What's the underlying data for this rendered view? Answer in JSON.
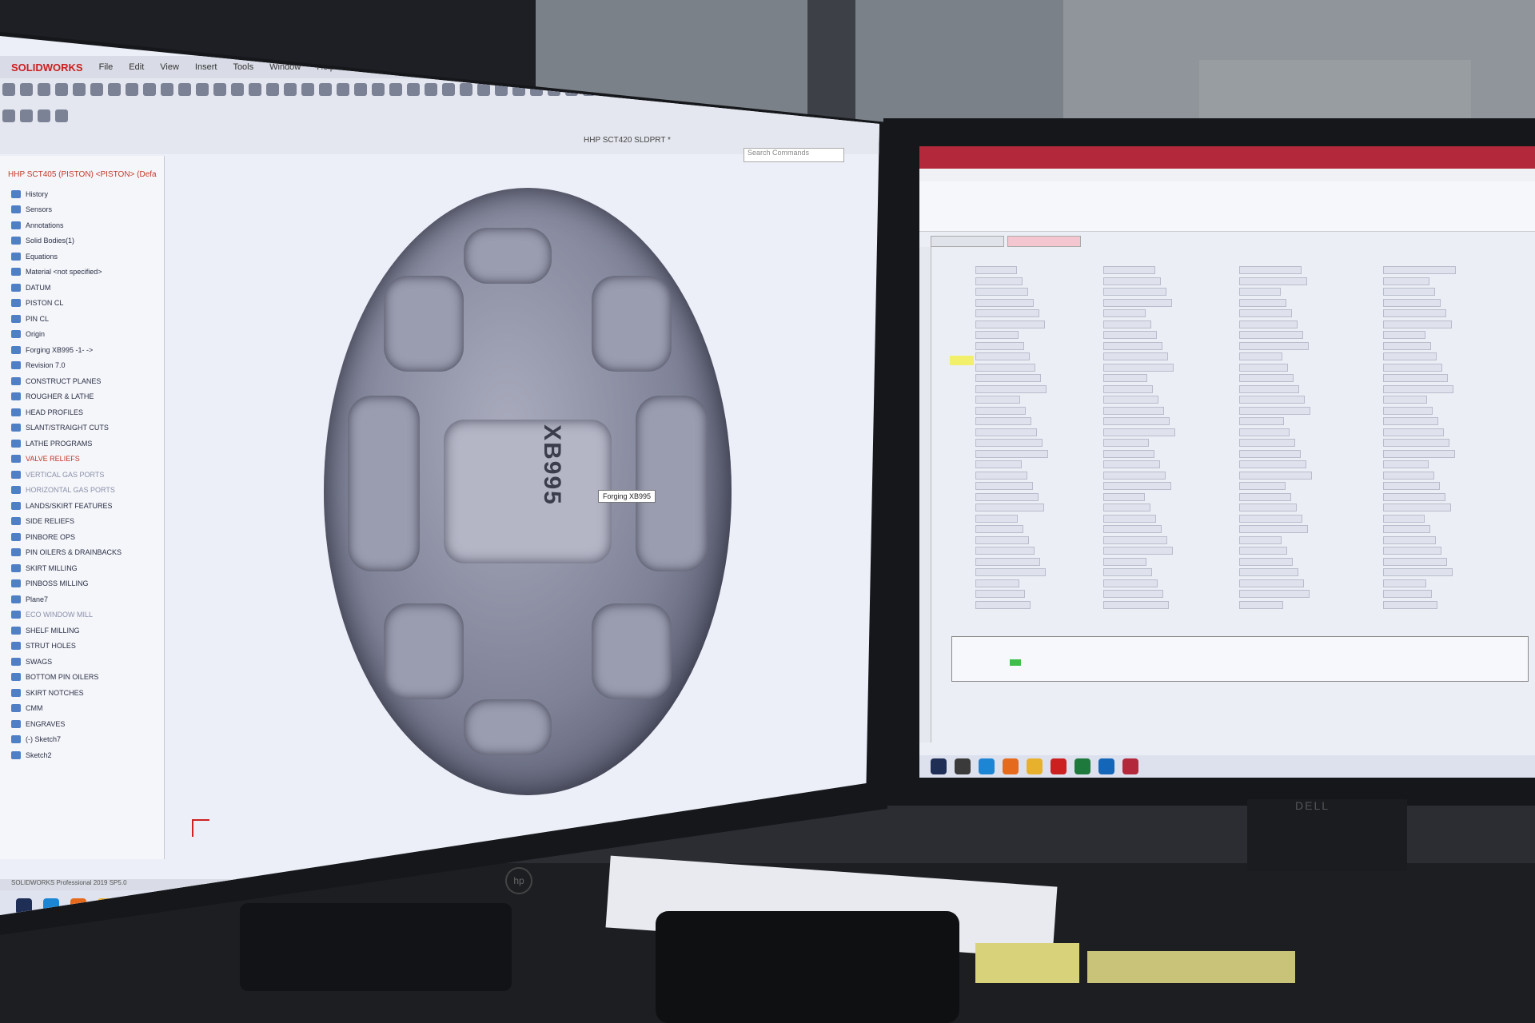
{
  "left_app": {
    "brand": "SOLIDWORKS",
    "menu": [
      "File",
      "Edit",
      "View",
      "Insert",
      "Tools",
      "Window",
      "Help"
    ],
    "document_title": "HHP SCT420 SLDPRT *",
    "search_placeholder": "Search Commands",
    "tree_root": "HHP SCT405 (PISTON) <PISTON> (Defa",
    "tree_items": [
      {
        "label": "History",
        "style": "normal"
      },
      {
        "label": "Sensors",
        "style": "normal"
      },
      {
        "label": "Annotations",
        "style": "normal"
      },
      {
        "label": "Solid Bodies(1)",
        "style": "normal"
      },
      {
        "label": "Equations",
        "style": "normal"
      },
      {
        "label": "Material <not specified>",
        "style": "normal"
      },
      {
        "label": "DATUM",
        "style": "normal"
      },
      {
        "label": "PISTON CL",
        "style": "normal"
      },
      {
        "label": "PIN CL",
        "style": "normal"
      },
      {
        "label": "Origin",
        "style": "normal"
      },
      {
        "label": "Forging XB995 -1- ->",
        "style": "normal"
      },
      {
        "label": "Revision 7.0",
        "style": "normal"
      },
      {
        "label": "CONSTRUCT PLANES",
        "style": "normal"
      },
      {
        "label": "ROUGHER & LATHE",
        "style": "normal"
      },
      {
        "label": "HEAD PROFILES",
        "style": "normal"
      },
      {
        "label": "SLANT/STRAIGHT CUTS",
        "style": "normal"
      },
      {
        "label": "LATHE PROGRAMS",
        "style": "normal"
      },
      {
        "label": "VALVE RELIEFS",
        "style": "red"
      },
      {
        "label": "VERTICAL GAS PORTS",
        "style": "dim"
      },
      {
        "label": "HORIZONTAL GAS PORTS",
        "style": "dim"
      },
      {
        "label": "LANDS/SKIRT FEATURES",
        "style": "normal"
      },
      {
        "label": "SIDE RELIEFS",
        "style": "normal"
      },
      {
        "label": "PINBORE OPS",
        "style": "normal"
      },
      {
        "label": "PIN OILERS & DRAINBACKS",
        "style": "normal"
      },
      {
        "label": "SKIRT MILLING",
        "style": "normal"
      },
      {
        "label": "PINBOSS MILLING",
        "style": "normal"
      },
      {
        "label": "Plane7",
        "style": "normal"
      },
      {
        "label": "ECO WINDOW MILL",
        "style": "dim"
      },
      {
        "label": "SHELF MILLING",
        "style": "normal"
      },
      {
        "label": "STRUT HOLES",
        "style": "normal"
      },
      {
        "label": "SWAGS",
        "style": "normal"
      },
      {
        "label": "BOTTOM PIN OILERS",
        "style": "normal"
      },
      {
        "label": "SKIRT NOTCHES",
        "style": "normal"
      },
      {
        "label": "CMM",
        "style": "normal"
      },
      {
        "label": "ENGRAVES",
        "style": "normal"
      },
      {
        "label": "(-) Sketch7",
        "style": "normal"
      },
      {
        "label": "Sketch2",
        "style": "normal"
      }
    ],
    "part_engraving": "XB995",
    "tooltip": "Forging XB995",
    "status_bar": "SOLIDWORKS Professional 2019 SP5.0"
  },
  "colors": {
    "solidworks_red": "#cc1f1f",
    "access_header": "#b3283b",
    "tree_folder": "#4f7fc4",
    "highlight_field": "#f2f06a",
    "status_green": "#3fbf4a"
  },
  "icons": [
    "start-icon",
    "search-icon",
    "edge-icon",
    "firefox-icon",
    "file-explorer-icon",
    "store-icon",
    "solidworks-icon",
    "excel-icon",
    "outlook-icon",
    "access-icon"
  ]
}
